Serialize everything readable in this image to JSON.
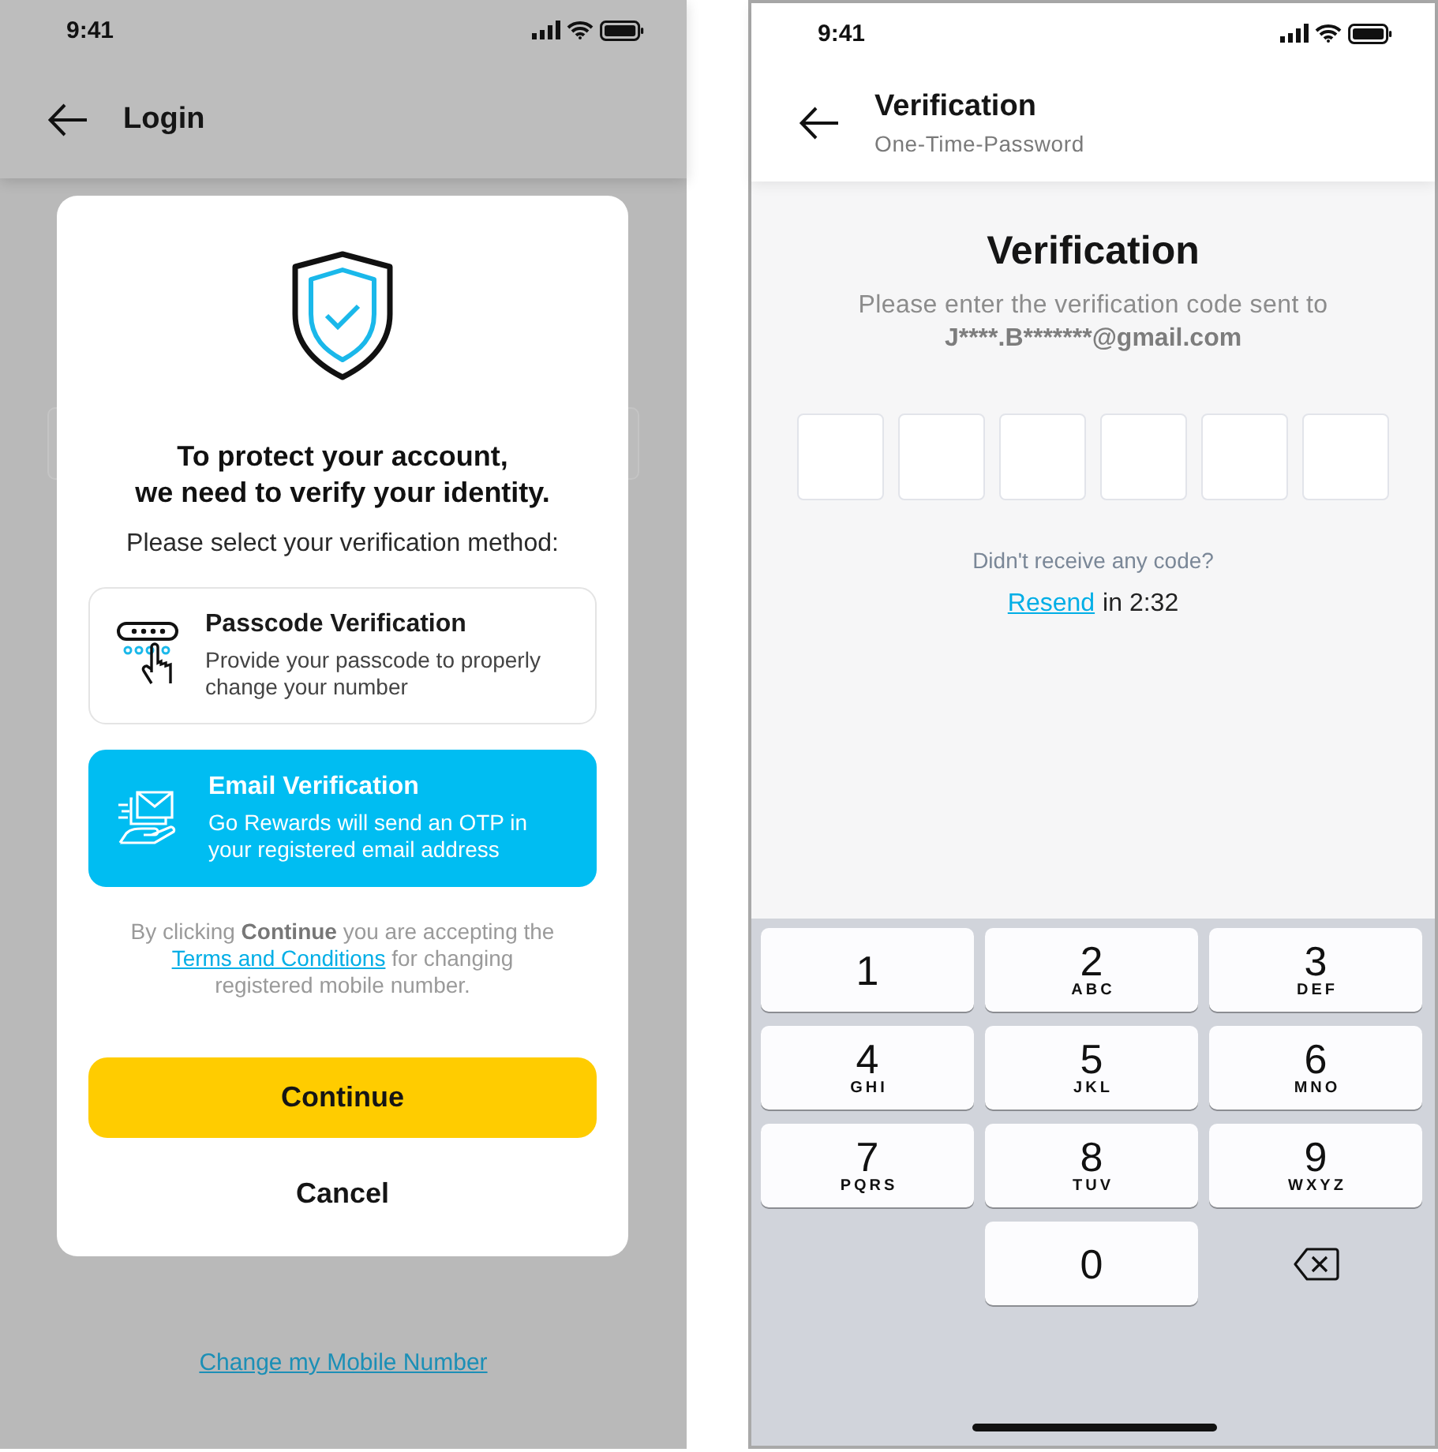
{
  "login_screen": {
    "status_bar": {
      "time": "9:41"
    },
    "header": {
      "title": "Login"
    },
    "link": "Change my Mobile Number",
    "dialog": {
      "heading_lines": [
        "To protect your account,",
        "we need to verify your identity."
      ],
      "prompt": "Please select your verification method:",
      "options": [
        {
          "title": "Passcode Verification",
          "description": "Provide your passcode to properly change your number",
          "selected": false
        },
        {
          "title": "Email Verification",
          "description": "Go Rewards will send an OTP in your registered email address",
          "selected": true
        }
      ],
      "terms_before": "By clicking **Continue** you are accepting the",
      "terms_link": "Terms and Conditions",
      "terms_after": "for changing registered mobile number.",
      "buttons": [
        {
          "label": "Continue",
          "kind": "primary"
        },
        {
          "label": "Cancel",
          "kind": "text"
        }
      ]
    }
  },
  "verification_screen": {
    "status_bar": {
      "time": "9:41"
    },
    "header": {
      "title": "Verification",
      "subtitle": "One-Time-Password"
    },
    "title": "Verification",
    "instruction": "Please enter the verification code sent to",
    "email": "J****.B*******@gmail.com",
    "otp_boxes": [
      {
        "filled": false
      },
      {
        "filled": false
      },
      {
        "filled": false
      },
      {
        "filled": false
      },
      {
        "filled": false
      },
      {
        "filled": false
      }
    ],
    "no_code_text": "Didn't receive any code?",
    "resend_link": "Resend",
    "countdown": "in 2:32",
    "keypad": [
      {
        "kind": "digit",
        "digit": "1"
      },
      {
        "kind": "digit",
        "digit": "2",
        "letters": "ABC"
      },
      {
        "kind": "digit",
        "digit": "3",
        "letters": "DEF"
      },
      {
        "kind": "digit",
        "digit": "4",
        "letters": "GHI"
      },
      {
        "kind": "digit",
        "digit": "5",
        "letters": "JKL"
      },
      {
        "kind": "digit",
        "digit": "6",
        "letters": "MNO"
      },
      {
        "kind": "digit",
        "digit": "7",
        "letters": "PQRS"
      },
      {
        "kind": "digit",
        "digit": "8",
        "letters": "TUV"
      },
      {
        "kind": "digit",
        "digit": "9",
        "letters": "WXYZ"
      },
      {
        "kind": "digit",
        "digit": "0"
      },
      {
        "kind": "backspace"
      }
    ]
  }
}
